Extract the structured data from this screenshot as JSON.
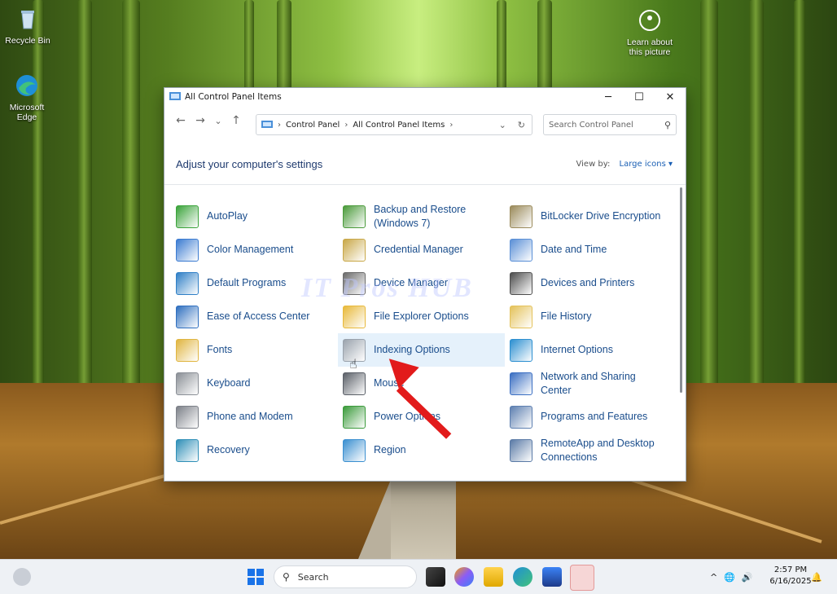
{
  "desktop": {
    "icons": [
      {
        "label": "Recycle Bin"
      },
      {
        "label": "Microsoft Edge"
      },
      {
        "label": "Learn about this picture"
      }
    ]
  },
  "window": {
    "title": "All Control Panel Items",
    "controls": {
      "minimize": "─",
      "maximize": "☐",
      "close": "✕"
    },
    "nav": {
      "back": "←",
      "forward": "→",
      "recent": "⌄",
      "up": "↑"
    },
    "address": {
      "crumbs": [
        "Control Panel",
        "All Control Panel Items"
      ],
      "separator": "›"
    },
    "search": {
      "placeholder": "Search Control Panel"
    },
    "heading": "Adjust your computer's settings",
    "view_by": {
      "label": "View by:",
      "value": "Large icons ▾"
    },
    "items": [
      {
        "label": "AutoPlay",
        "color": "#3aa33a"
      },
      {
        "label": "Backup and Restore (Windows 7)",
        "color": "#4a9a3a"
      },
      {
        "label": "BitLocker Drive Encryption",
        "color": "#9a8a5a"
      },
      {
        "label": "Color Management",
        "color": "#3b7bd1"
      },
      {
        "label": "Credential Manager",
        "color": "#c9a848"
      },
      {
        "label": "Date and Time",
        "color": "#5a8fd6"
      },
      {
        "label": "Default Programs",
        "color": "#2f7fc6"
      },
      {
        "label": "Device Manager",
        "color": "#6b6b6b"
      },
      {
        "label": "Devices and Printers",
        "color": "#4d4d4d"
      },
      {
        "label": "Ease of Access Center",
        "color": "#2f6fbf"
      },
      {
        "label": "File Explorer Options",
        "color": "#e8b93a"
      },
      {
        "label": "File History",
        "color": "#e4c25a"
      },
      {
        "label": "Fonts",
        "color": "#e0b540"
      },
      {
        "label": "Indexing Options",
        "color": "#9aa3ad"
      },
      {
        "label": "Internet Options",
        "color": "#2c8fd0"
      },
      {
        "label": "Keyboard",
        "color": "#8a8f96"
      },
      {
        "label": "Mouse",
        "color": "#5b6068"
      },
      {
        "label": "Network and Sharing Center",
        "color": "#3a6ec2"
      },
      {
        "label": "Phone and Modem",
        "color": "#7c8088"
      },
      {
        "label": "Power Options",
        "color": "#3a9a3a"
      },
      {
        "label": "Programs and Features",
        "color": "#5d7fb0"
      },
      {
        "label": "Recovery",
        "color": "#2f8fb7"
      },
      {
        "label": "Region",
        "color": "#3a8fd0"
      },
      {
        "label": "RemoteApp and Desktop Connections",
        "color": "#5a7aa6"
      }
    ],
    "highlighted_item": "Indexing Options"
  },
  "watermark": "IT Pros HUB",
  "taskbar": {
    "search_label": "Search",
    "time": "2:57 PM",
    "date": "6/16/2025",
    "tray": {
      "chevron": "^",
      "network": "🌐",
      "volume": "🔊",
      "bell": "🔔"
    }
  }
}
